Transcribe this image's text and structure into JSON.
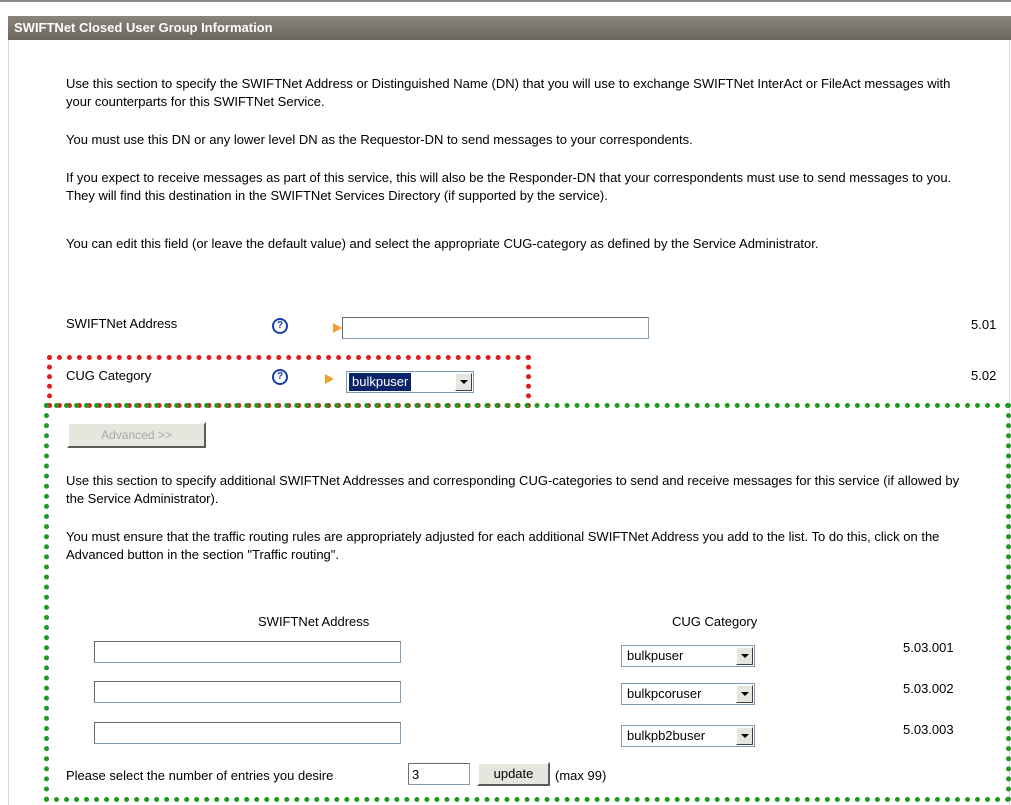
{
  "section_title": "SWIFTNet Closed User Group Information",
  "intro": {
    "p1": "Use this section to specify the SWIFTNet Address or Distinguished Name (DN) that you will use to exchange SWIFTNet InterAct or FileAct messages with your counterparts for this SWIFTNet Service.",
    "p2": "You must use this DN or any lower level DN as the Requestor-DN to send messages to your correspondents.",
    "p3": "If you expect to receive messages as part of this service, this will also be the Responder-DN that your correspondents must use to send messages to you. They will find this destination in the SWIFTNet Services Directory (if supported by the service).",
    "p4": "You can edit this field (or leave the default value) and select the appropriate CUG-category as defined by the Service Administrator."
  },
  "fields": {
    "address": {
      "label": "SWIFTNet Address",
      "value": "",
      "ref": "5.01",
      "help": "?"
    },
    "cug": {
      "label": "CUG Category",
      "selected": "bulkpuser",
      "ref": "5.02",
      "help": "?"
    }
  },
  "advanced": {
    "button_label": "Advanced >>",
    "p1": "Use this section to specify additional SWIFTNet Addresses and corresponding CUG-categories to send and receive messages for this service (if allowed by the Service Administrator).",
    "p2": "You must ensure that the traffic routing rules are appropriately adjusted for each additional SWIFTNet Address you add to the list. To do this, click on the Advanced button in the section \"Traffic routing\".",
    "col_address": "SWIFTNet Address",
    "col_cug": "CUG Category",
    "rows": [
      {
        "address": "",
        "cug": "bulkpuser",
        "ref": "5.03.001"
      },
      {
        "address": "",
        "cug": "bulkpcoruser",
        "ref": "5.03.002"
      },
      {
        "address": "",
        "cug": "bulkpb2buser",
        "ref": "5.03.003"
      }
    ],
    "entries_prompt": "Please select the number of entries you desire",
    "entries_value": "3",
    "update_label": "update",
    "max_note": "(max 99)"
  },
  "colors": {
    "title_bar": "#7a756d",
    "highlight_red": "#e21b1b",
    "highlight_green": "#1e9a1e",
    "arrow": "#f0a030",
    "help_icon": "#1a3ea8"
  }
}
